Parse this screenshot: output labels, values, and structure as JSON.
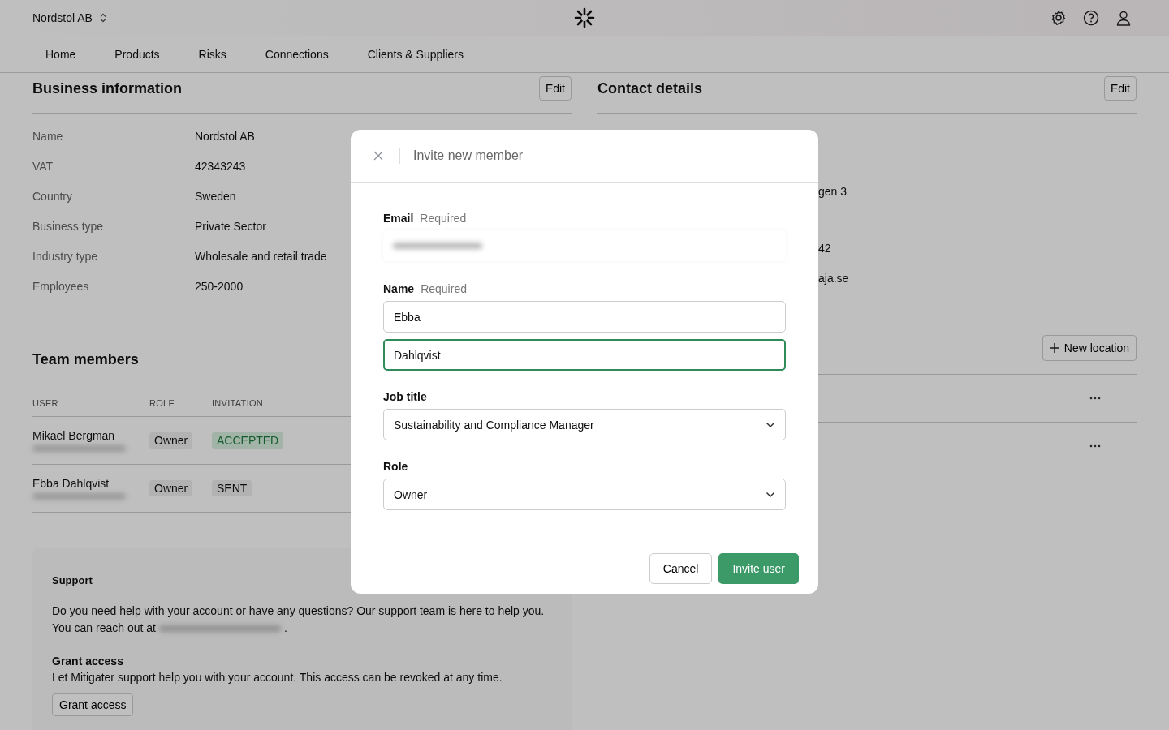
{
  "header": {
    "organization": "Nordstol AB"
  },
  "nav": [
    {
      "label": "Home",
      "selected": false
    },
    {
      "label": "Products",
      "selected": false
    },
    {
      "label": "Risks",
      "selected": false
    },
    {
      "label": "Connections",
      "selected": false
    },
    {
      "label": "Clients & Suppliers",
      "selected": false
    }
  ],
  "business_information": {
    "title": "Business information",
    "edit_button": "Edit",
    "rows": [
      {
        "label": "Name",
        "value": "Nordstol AB"
      },
      {
        "label": "VAT",
        "value": "42343243"
      },
      {
        "label": "Country",
        "value": "Sweden"
      },
      {
        "label": "Business type",
        "value": "Private Sector"
      },
      {
        "label": "Industry type",
        "value": "Wholesale and retail trade"
      },
      {
        "label": "Employees",
        "value": "250-2000"
      }
    ]
  },
  "team_members": {
    "title": "Team members",
    "columns": [
      "USER",
      "ROLE",
      "INVITATION"
    ],
    "rows": [
      {
        "name": "Mikael Bergman",
        "role": "Owner",
        "invitation": "ACCEPTED",
        "kind": "accepted"
      },
      {
        "name": "Ebba Dahlqvist",
        "role": "Owner",
        "invitation": "SENT",
        "kind": "sent"
      }
    ]
  },
  "support": {
    "title": "Support",
    "text": "Do you need help with your account or have any questions? Our support team is here to help you.",
    "reach_prefix": "You can reach out at",
    "reach_suffix": ".",
    "grant_title": "Grant access",
    "grant_text": "Let Mitigater support help you with your account. This access can be revoked at any time.",
    "grant_button": "Grant access"
  },
  "contact_details": {
    "title": "Contact details",
    "edit_button": "Edit",
    "values": [
      "gen 3",
      "42",
      "aja.se"
    ]
  },
  "locations": {
    "new_button": "New location"
  },
  "modal": {
    "title": "Invite new member",
    "email": {
      "label": "Email",
      "hint": "Required"
    },
    "name": {
      "label": "Name",
      "hint": "Required",
      "first": "Ebba",
      "last": "Dahlqvist",
      "last_focused": true
    },
    "job_title": {
      "label": "Job title",
      "value": "Sustainability and Compliance Manager"
    },
    "role": {
      "label": "Role",
      "value": "Owner"
    },
    "cancel": "Cancel",
    "submit": "Invite user"
  }
}
